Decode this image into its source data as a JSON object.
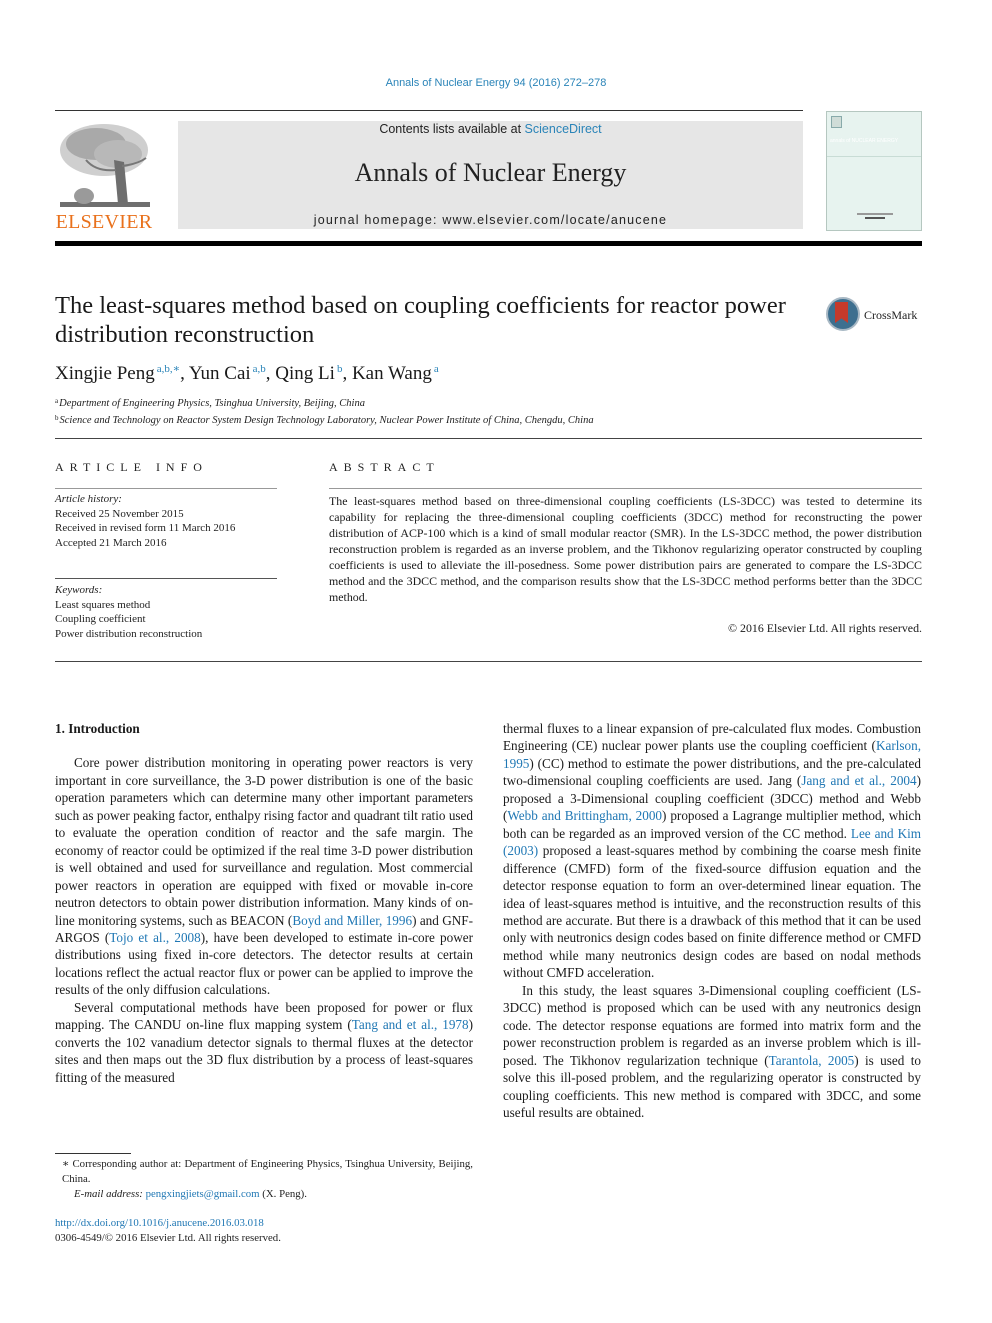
{
  "journal_reference": "Annals of Nuclear Energy 94 (2016) 272–278",
  "header": {
    "publisher_logo": "ELSEVIER",
    "contents_prefix": "Contents lists available at ",
    "contents_link": "ScienceDirect",
    "journal_name": "Annals of Nuclear Energy",
    "homepage": "journal homepage: www.elsevier.com/locate/anucene",
    "cover_title": "annals of NUCLEAR ENERGY"
  },
  "article": {
    "title": "The least-squares method based on coupling coefficients for reactor power distribution reconstruction",
    "crossmark_label": "CrossMark",
    "authors": [
      {
        "name": "Xingjie Peng",
        "sup": "a,b,∗",
        "sep": ", "
      },
      {
        "name": "Yun Cai",
        "sup": "a,b",
        "sep": ", "
      },
      {
        "name": "Qing Li",
        "sup": "b",
        "sep": ", "
      },
      {
        "name": "Kan Wang",
        "sup": "a",
        "sep": ""
      }
    ],
    "affiliations": [
      {
        "mark": "a",
        "text": "Department of Engineering Physics, Tsinghua University, Beijing, China"
      },
      {
        "mark": "b",
        "text": "Science and Technology on Reactor System Design Technology Laboratory, Nuclear Power Institute of China, Chengdu, China"
      }
    ]
  },
  "article_info": {
    "heading": "ARTICLE INFO",
    "history_label": "Article history:",
    "history": [
      "Received 25 November 2015",
      "Received in revised form 11 March 2016",
      "Accepted 21 March 2016"
    ],
    "keywords_label": "Keywords:",
    "keywords": [
      "Least squares method",
      "Coupling coefficient",
      "Power distribution reconstruction"
    ]
  },
  "abstract": {
    "heading": "ABSTRACT",
    "text": "The least-squares method based on three-dimensional coupling coefficients (LS-3DCC) was tested to determine its capability for replacing the three-dimensional coupling coefficients (3DCC) method for reconstructing the power distribution of ACP-100 which is a kind of small modular reactor (SMR). In the LS-3DCC method, the power distribution reconstruction problem is regarded as an inverse problem, and the Tikhonov regularizing operator constructed by coupling coefficients is used to alleviate the ill-posedness. Some power distribution pairs are generated to compare the LS-3DCC method and the 3DCC method, and the comparison results show that the LS-3DCC method performs better than the 3DCC method.",
    "copyright": "© 2016 Elsevier Ltd. All rights reserved."
  },
  "body": {
    "section_heading": "1. Introduction",
    "p1": [
      {
        "t": "Core power distribution monitoring in operating power reactors is very important in core surveillance, the 3-D power distribution is one of the basic operation parameters which can determine many other important parameters such as power peaking factor, enthalpy rising factor and quadrant tilt ratio used to evaluate the operation condition of reactor and the safe margin. The economy of reactor could be optimized if the real time 3-D power distribution is well obtained and used for surveillance and regulation. Most commercial power reactors in operation are equipped with fixed or movable in-core neutron detectors to obtain power distribution information. Many kinds of on-line monitoring systems, such as BEACON ("
      },
      {
        "link": "Boyd and Miller, 1996"
      },
      {
        "t": ") and GNF-ARGOS ("
      },
      {
        "link": "Tojo et al., 2008"
      },
      {
        "t": "), have been developed to estimate in-core power distributions using fixed in-core detectors. The detector results at certain locations reflect the actual reactor flux or power can be applied to improve the results of the only diffusion calculations."
      }
    ],
    "p2": [
      {
        "t": "Several computational methods have been proposed for power or flux mapping. The CANDU on-line flux mapping system ("
      },
      {
        "link": "Tang and et al., 1978"
      },
      {
        "t": ") converts the 102 vanadium detector signals to thermal fluxes at the detector sites and then maps out the 3D flux distribution by a process of least-squares fitting of the measured"
      }
    ],
    "p2_cont": [
      {
        "t": "thermal fluxes to a linear expansion of pre-calculated flux modes. Combustion Engineering (CE) nuclear power plants use the coupling coefficient ("
      },
      {
        "link": "Karlson, 1995"
      },
      {
        "t": ") (CC) method to estimate the power distributions, and the pre-calculated two-dimensional coupling coefficients are used. Jang ("
      },
      {
        "link": "Jang and et al., 2004"
      },
      {
        "t": ") proposed a 3-Dimensional coupling coefficient (3DCC) method and Webb ("
      },
      {
        "link": "Webb and Brittingham, 2000"
      },
      {
        "t": ") proposed a Lagrange multiplier method, which both can be regarded as an improved version of the CC method. "
      },
      {
        "link": "Lee and Kim (2003)"
      },
      {
        "t": " proposed a least-squares method by combining the coarse mesh finite difference (CMFD) form of the fixed-source diffusion equation and the detector response equation to form an over-determined linear equation. The idea of least-squares method is intuitive, and the reconstruction results of this method are accurate. But there is a drawback of this method that it can be used only with neutronics design codes based on finite difference method or CMFD method while many neutronics design codes are based on nodal methods without CMFD acceleration."
      }
    ],
    "p3": [
      {
        "t": "In this study, the least squares 3-Dimensional coupling coefficient (LS-3DCC) method is proposed which can be used with any neutronics design code. The detector response equations are formed into matrix form and the power reconstruction problem is regarded as an inverse problem which is ill-posed. The Tikhonov regularization technique ("
      },
      {
        "link": "Tarantola, 2005"
      },
      {
        "t": ") is used to solve this ill-posed problem, and the regularizing operator is constructed by coupling coefficients. This new method is compared with 3DCC, and some useful results are obtained."
      }
    ]
  },
  "footnote": {
    "corresponding": "∗ Corresponding author at: Department of Engineering Physics, Tsinghua University, Beijing, China.",
    "email_label": "E-mail address: ",
    "email": "pengxingjiets@gmail.com",
    "email_suffix": " (X. Peng)."
  },
  "doi": {
    "url": "http://dx.doi.org/10.1016/j.anucene.2016.03.018",
    "issn_line": "0306-4549/© 2016 Elsevier Ltd. All rights reserved."
  },
  "colors": {
    "link": "#2a84b8",
    "elsevier_orange": "#e9711c",
    "header_gray": "#e6e6e6",
    "crossmark_red": "#c63a2b"
  }
}
